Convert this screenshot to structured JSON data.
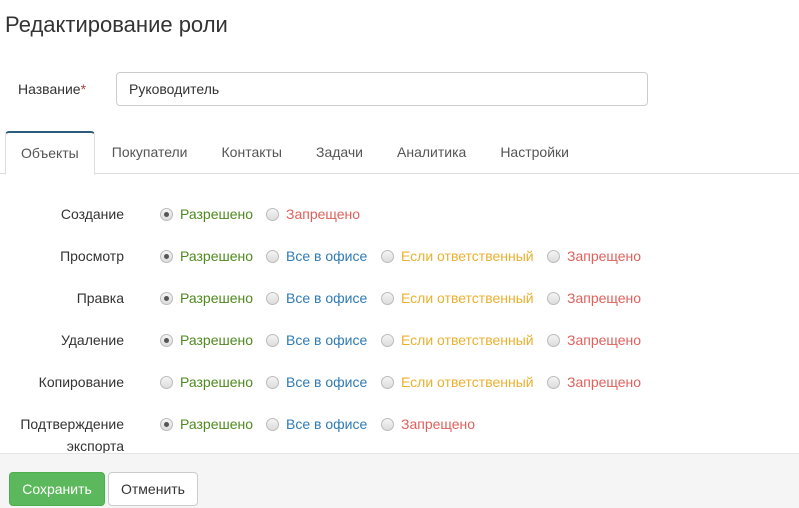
{
  "title": "Редактирование роли",
  "name_field": {
    "label": "Название",
    "required_mark": "*",
    "value": "Руководитель"
  },
  "tabs": [
    {
      "label": "Объекты",
      "active": true
    },
    {
      "label": "Покупатели"
    },
    {
      "label": "Контакты"
    },
    {
      "label": "Задачи"
    },
    {
      "label": "Аналитика"
    },
    {
      "label": "Настройки"
    }
  ],
  "permissions": [
    {
      "label": "Создание",
      "options": [
        {
          "label": "Разрешено",
          "color": "green",
          "checked": true
        },
        {
          "label": "Запрещено",
          "color": "red"
        }
      ]
    },
    {
      "label": "Просмотр",
      "options": [
        {
          "label": "Разрешено",
          "color": "green",
          "checked": true
        },
        {
          "label": "Все в офисе",
          "color": "blue"
        },
        {
          "label": "Если ответственный",
          "color": "orange"
        },
        {
          "label": "Запрещено",
          "color": "red"
        }
      ]
    },
    {
      "label": "Правка",
      "options": [
        {
          "label": "Разрешено",
          "color": "green",
          "checked": true
        },
        {
          "label": "Все в офисе",
          "color": "blue"
        },
        {
          "label": "Если ответственный",
          "color": "orange"
        },
        {
          "label": "Запрещено",
          "color": "red"
        }
      ]
    },
    {
      "label": "Удаление",
      "options": [
        {
          "label": "Разрешено",
          "color": "green",
          "checked": true
        },
        {
          "label": "Все в офисе",
          "color": "blue"
        },
        {
          "label": "Если ответственный",
          "color": "orange"
        },
        {
          "label": "Запрещено",
          "color": "red"
        }
      ]
    },
    {
      "label": "Копирование",
      "options": [
        {
          "label": "Разрешено",
          "color": "green",
          "checked": false
        },
        {
          "label": "Все в офисе",
          "color": "blue"
        },
        {
          "label": "Если ответственный",
          "color": "orange"
        },
        {
          "label": "Запрещено",
          "color": "red"
        }
      ]
    },
    {
      "label": "Подтверждение экспорта",
      "options": [
        {
          "label": "Разрешено",
          "color": "green",
          "checked": true
        },
        {
          "label": "Все в офисе",
          "color": "blue"
        },
        {
          "label": "Запрещено",
          "color": "red"
        }
      ]
    }
  ],
  "buttons": {
    "save": "Сохранить",
    "cancel": "Отменить"
  },
  "colors": {
    "green": "#4e8a1e",
    "blue": "#2f7bb5",
    "orange": "#ebb02f",
    "red": "#e0605c",
    "primary": "#5cb85c"
  }
}
